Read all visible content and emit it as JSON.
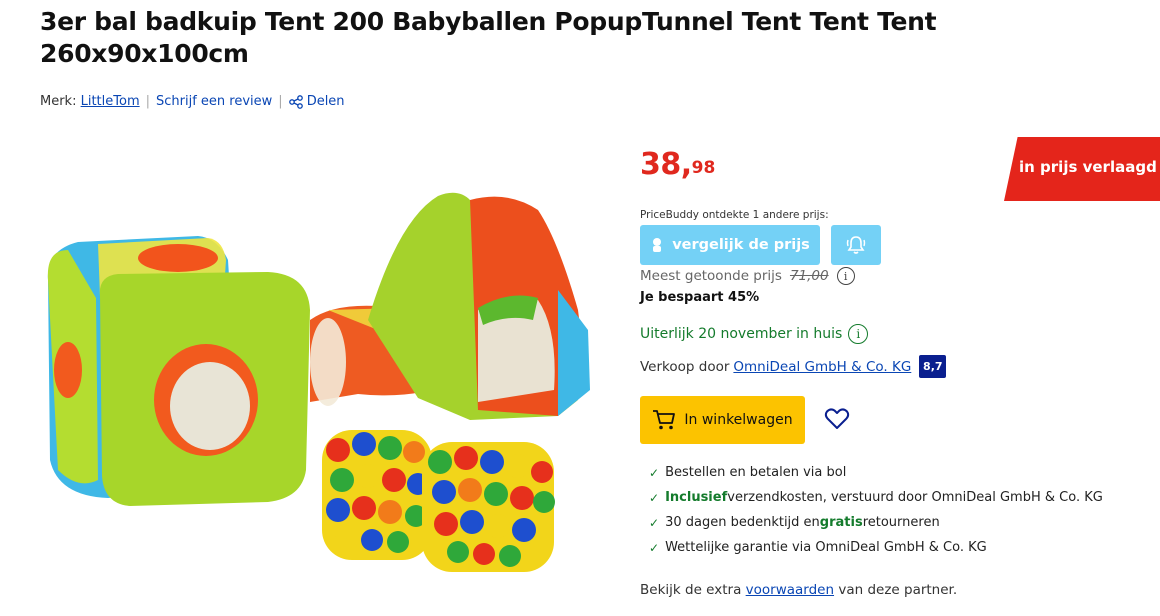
{
  "product": {
    "title": "3er bal badkuip Tent 200 Babyballen PopupTunnel Tent Tent Tent 260x90x100cm"
  },
  "meta": {
    "brand_prefix": "Merk:",
    "brand": "LittleTom",
    "review_link": "Schrijf een review",
    "share_label": "Delen"
  },
  "pricing": {
    "price_main": "38,",
    "price_cents": "98",
    "badge": "in prijs verlaagd",
    "pricebuddy_label": "PriceBuddy ontdekte 1 andere prijs:",
    "compare_button": "vergelijk de prijs",
    "most_shown_label": "Meest getoonde prijs",
    "old_price": "71,00",
    "savings": "Je bespaart 45%"
  },
  "delivery": {
    "text": "Uiterlijk 20 november in huis"
  },
  "seller": {
    "prefix": "Verkoop door",
    "name": "OmniDeal GmbH & Co. KG",
    "score": "8,7"
  },
  "actions": {
    "cart_button": "In winkelwagen"
  },
  "usps": [
    {
      "pre": "",
      "highlight": "",
      "post": "Bestellen en betalen via bol"
    },
    {
      "pre": "",
      "highlight": "Inclusief",
      "post": " verzendkosten, verstuurd door OmniDeal GmbH & Co. KG"
    },
    {
      "pre": "30 dagen bedenktijd en ",
      "highlight": "gratis",
      "post": " retourneren"
    },
    {
      "pre": "",
      "highlight": "",
      "post": "Wettelijke garantie via OmniDeal GmbH & Co. KG"
    }
  ],
  "partner": {
    "pre": "Bekijk de extra",
    "link": "voorwaarden",
    "post": "van deze partner."
  },
  "colors": {
    "price_red": "#e0281e",
    "badge_red": "#e4251b",
    "link_blue": "#0a46b4",
    "pricebuddy_blue": "#74d1f6",
    "cart_yellow": "#fcc300",
    "green": "#147b2c"
  },
  "icons": {
    "share": "share-icon",
    "cart": "cart-icon",
    "heart": "heart-icon",
    "bell": "bell-icon",
    "info": "info-icon",
    "check": "check-icon"
  }
}
